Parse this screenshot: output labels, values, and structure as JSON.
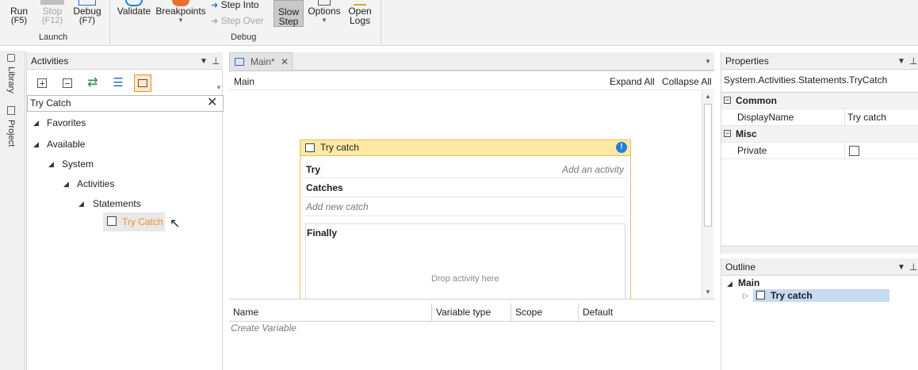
{
  "ribbon": {
    "run": {
      "label": "Run",
      "key": "(F5)"
    },
    "stop": {
      "label": "Stop",
      "key": "(F12)"
    },
    "debug": {
      "label": "Debug",
      "key": "(F7)"
    },
    "launch_group": "Launch",
    "validate": "Validate",
    "breakpoints": "Breakpoints",
    "step_into": "Step Into",
    "step_over": "Step Over",
    "slow_step": {
      "line1": "Slow",
      "line2": "Step"
    },
    "options": "Options",
    "open_logs": {
      "line1": "Open",
      "line2": "Logs"
    },
    "debug_group": "Debug"
  },
  "side_tabs": {
    "library": "Library",
    "project": "Project"
  },
  "activities": {
    "title": "Activities",
    "search_value": "Try Catch",
    "tree": {
      "favorites": "Favorites",
      "available": "Available",
      "system": "System",
      "activities": "Activities",
      "statements": "Statements",
      "try_catch": "Try Catch"
    }
  },
  "document": {
    "tab_label": "Main*",
    "breadcrumb": "Main",
    "expand_all": "Expand All",
    "collapse_all": "Collapse All",
    "try_catch": {
      "title": "Try catch",
      "try_label": "Try",
      "add_activity": "Add an activity",
      "catches_label": "Catches",
      "add_catch": "Add new catch",
      "finally_label": "Finally",
      "drop_hint": "Drop activity here"
    },
    "variables": {
      "columns": [
        "Name",
        "Variable type",
        "Scope",
        "Default"
      ],
      "create": "Create Variable"
    }
  },
  "properties": {
    "title": "Properties",
    "type_name": "System.Activities.Statements.TryCatch",
    "common": "Common",
    "display_name_label": "DisplayName",
    "display_name_value": "Try catch",
    "misc": "Misc",
    "private_label": "Private"
  },
  "outline": {
    "title": "Outline",
    "main": "Main",
    "try_catch": "Try catch"
  },
  "colors": {
    "accent": "#e8912d",
    "activity_header": "#fde9a4",
    "selection": "#c4dbf0",
    "info_blue": "#1f7fe0"
  }
}
